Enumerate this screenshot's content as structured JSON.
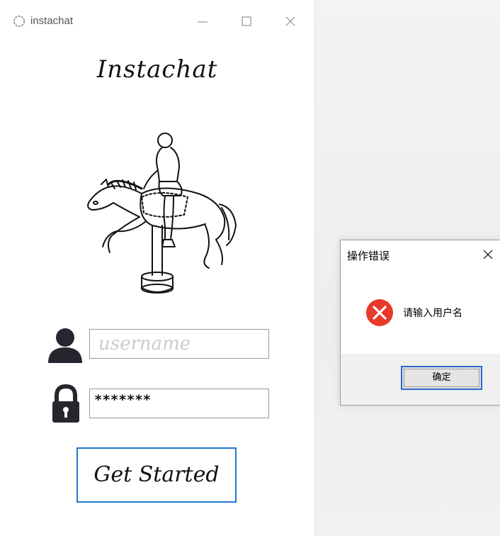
{
  "app_window": {
    "title": "instachat",
    "heading": "Instachat",
    "username_placeholder": "username",
    "password_value": "*******",
    "get_started_label": "Get Started"
  },
  "dialog": {
    "title": "操作错误",
    "message": "请输入用户名",
    "ok_label": "确定"
  },
  "colors": {
    "accent": "#1f78cf",
    "error": "#e8392a",
    "icon_dark": "#26262e"
  }
}
